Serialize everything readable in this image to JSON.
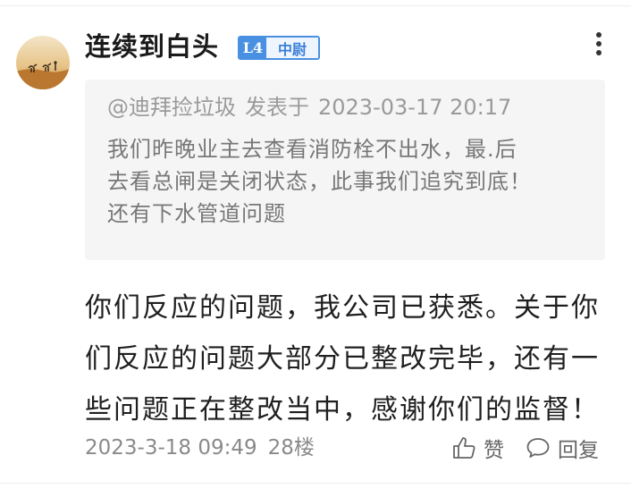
{
  "comment": {
    "username": "连续到白头",
    "level_badge": {
      "level": "L4",
      "rank": "中尉",
      "color": "#4a90e2"
    },
    "quote": {
      "author": "@迪拜捡垃圾",
      "posted_label": "发表于",
      "datetime": "2023-03-17 20:17",
      "lines": [
        "我们昨晚业主去查看消防栓不出水，最.后",
        "去看总闸是关闭状态，此事我们追究到底！",
        "还有下水管道问题"
      ]
    },
    "reply_lines": [
      "你们反应的问题，我公司已获悉。关于你",
      "们反应的问题大部分已整改完毕，还有一",
      "些问题正在整改当中，感谢你们的监督！"
    ],
    "footer": {
      "time": "2023-3-18 09:49",
      "floor": "28楼",
      "like_label": "赞",
      "reply_label": "回复"
    }
  },
  "icons": {
    "more": "more-vertical-icon",
    "like": "thumbs-up-icon",
    "reply": "speech-bubble-icon"
  }
}
